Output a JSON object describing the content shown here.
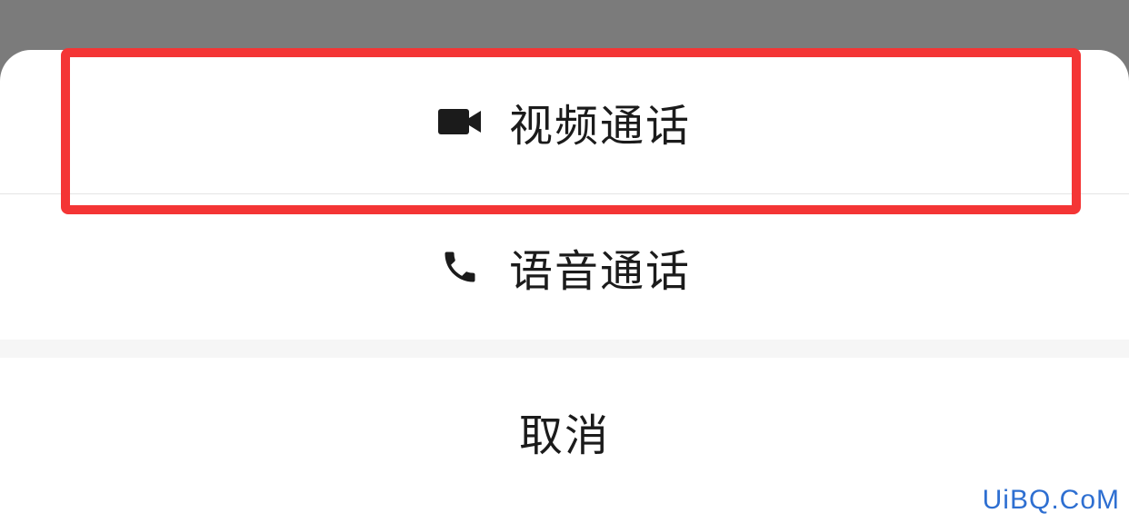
{
  "sheet": {
    "options": [
      {
        "label": "视频通话",
        "icon": "video-camera-icon"
      },
      {
        "label": "语音通话",
        "icon": "phone-icon"
      }
    ],
    "cancel_label": "取消"
  },
  "watermark": "UiBQ.CoM",
  "colors": {
    "overlay": "#7b7b7b",
    "highlight": "#f43535",
    "text": "#1b1b1b",
    "watermark": "#2e6fd1"
  }
}
